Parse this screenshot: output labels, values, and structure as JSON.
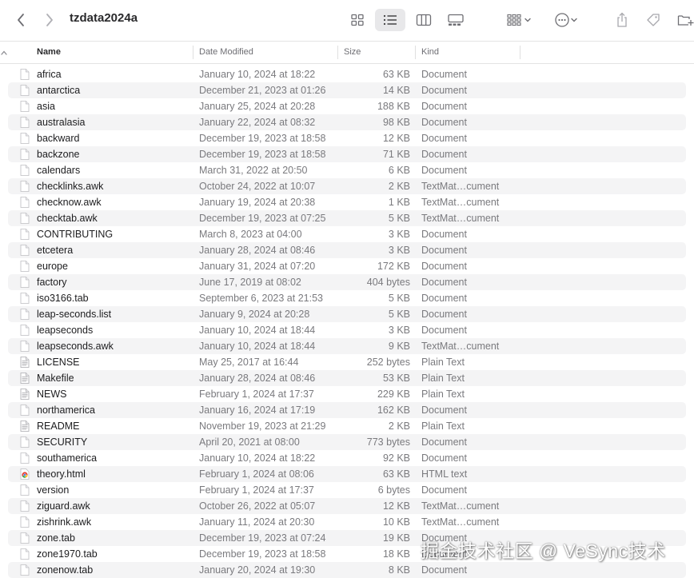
{
  "window": {
    "title": "tzdata2024a"
  },
  "toolbar": {
    "back": "chevron-left-icon",
    "forward": "chevron-right-icon",
    "views": [
      "icon-view-icon",
      "list-view-icon",
      "column-view-icon",
      "gallery-view-icon"
    ],
    "selected_view": "list-view-icon",
    "group": "group-grid-icon",
    "action": "ellipsis-circle-icon",
    "share": "share-icon",
    "tag": "tag-icon",
    "new_folder": "folder-badge-plus-icon"
  },
  "columns": {
    "name": "Name",
    "date_modified": "Date Modified",
    "size": "Size",
    "kind": "Kind",
    "sort_column": "Name",
    "sort_direction": "ascending"
  },
  "files": [
    {
      "name": "africa",
      "date": "January 10, 2024 at 18:22",
      "size": "63 KB",
      "kind": "Document",
      "icon": "document-icon"
    },
    {
      "name": "antarctica",
      "date": "December 21, 2023 at 01:26",
      "size": "14 KB",
      "kind": "Document",
      "icon": "document-icon"
    },
    {
      "name": "asia",
      "date": "January 25, 2024 at 20:28",
      "size": "188 KB",
      "kind": "Document",
      "icon": "document-icon"
    },
    {
      "name": "australasia",
      "date": "January 22, 2024 at 08:32",
      "size": "98 KB",
      "kind": "Document",
      "icon": "document-icon"
    },
    {
      "name": "backward",
      "date": "December 19, 2023 at 18:58",
      "size": "12 KB",
      "kind": "Document",
      "icon": "document-icon"
    },
    {
      "name": "backzone",
      "date": "December 19, 2023 at 18:58",
      "size": "71 KB",
      "kind": "Document",
      "icon": "document-icon"
    },
    {
      "name": "calendars",
      "date": "March 31, 2022 at 20:50",
      "size": "6 KB",
      "kind": "Document",
      "icon": "document-icon"
    },
    {
      "name": "checklinks.awk",
      "date": "October 24, 2022 at 10:07",
      "size": "2 KB",
      "kind": "TextMat…cument",
      "icon": "document-icon"
    },
    {
      "name": "checknow.awk",
      "date": "January 19, 2024 at 20:38",
      "size": "1 KB",
      "kind": "TextMat…cument",
      "icon": "document-icon"
    },
    {
      "name": "checktab.awk",
      "date": "December 19, 2023 at 07:25",
      "size": "5 KB",
      "kind": "TextMat…cument",
      "icon": "document-icon"
    },
    {
      "name": "CONTRIBUTING",
      "date": "March 8, 2023 at 04:00",
      "size": "3 KB",
      "kind": "Document",
      "icon": "document-icon"
    },
    {
      "name": "etcetera",
      "date": "January 28, 2024 at 08:46",
      "size": "3 KB",
      "kind": "Document",
      "icon": "document-icon"
    },
    {
      "name": "europe",
      "date": "January 31, 2024 at 07:20",
      "size": "172 KB",
      "kind": "Document",
      "icon": "document-icon"
    },
    {
      "name": "factory",
      "date": "June 17, 2019 at 08:02",
      "size": "404 bytes",
      "kind": "Document",
      "icon": "document-icon"
    },
    {
      "name": "iso3166.tab",
      "date": "September 6, 2023 at 21:53",
      "size": "5 KB",
      "kind": "Document",
      "icon": "document-icon"
    },
    {
      "name": "leap-seconds.list",
      "date": "January 9, 2024 at 20:28",
      "size": "5 KB",
      "kind": "Document",
      "icon": "document-icon"
    },
    {
      "name": "leapseconds",
      "date": "January 10, 2024 at 18:44",
      "size": "3 KB",
      "kind": "Document",
      "icon": "document-icon"
    },
    {
      "name": "leapseconds.awk",
      "date": "January 10, 2024 at 18:44",
      "size": "9 KB",
      "kind": "TextMat…cument",
      "icon": "document-icon"
    },
    {
      "name": "LICENSE",
      "date": "May 25, 2017 at 16:44",
      "size": "252 bytes",
      "kind": "Plain Text",
      "icon": "text-document-icon"
    },
    {
      "name": "Makefile",
      "date": "January 28, 2024 at 08:46",
      "size": "53 KB",
      "kind": "Plain Text",
      "icon": "text-document-icon"
    },
    {
      "name": "NEWS",
      "date": "February 1, 2024 at 17:37",
      "size": "229 KB",
      "kind": "Plain Text",
      "icon": "text-document-icon"
    },
    {
      "name": "northamerica",
      "date": "January 16, 2024 at 17:19",
      "size": "162 KB",
      "kind": "Document",
      "icon": "document-icon"
    },
    {
      "name": "README",
      "date": "November 19, 2023 at 21:29",
      "size": "2 KB",
      "kind": "Plain Text",
      "icon": "text-document-icon"
    },
    {
      "name": "SECURITY",
      "date": "April 20, 2021 at 08:00",
      "size": "773 bytes",
      "kind": "Document",
      "icon": "document-icon"
    },
    {
      "name": "southamerica",
      "date": "January 10, 2024 at 18:22",
      "size": "92 KB",
      "kind": "Document",
      "icon": "document-icon"
    },
    {
      "name": "theory.html",
      "date": "February 1, 2024 at 08:06",
      "size": "63 KB",
      "kind": "HTML text",
      "icon": "chrome-html-icon"
    },
    {
      "name": "version",
      "date": "February 1, 2024 at 17:37",
      "size": "6 bytes",
      "kind": "Document",
      "icon": "document-icon"
    },
    {
      "name": "ziguard.awk",
      "date": "October 26, 2022 at 05:07",
      "size": "12 KB",
      "kind": "TextMat…cument",
      "icon": "document-icon"
    },
    {
      "name": "zishrink.awk",
      "date": "January 11, 2024 at 20:30",
      "size": "10 KB",
      "kind": "TextMat…cument",
      "icon": "document-icon"
    },
    {
      "name": "zone.tab",
      "date": "December 19, 2023 at 07:24",
      "size": "19 KB",
      "kind": "Document",
      "icon": "document-icon"
    },
    {
      "name": "zone1970.tab",
      "date": "December 19, 2023 at 18:58",
      "size": "18 KB",
      "kind": "Document",
      "icon": "document-icon"
    },
    {
      "name": "zonenow.tab",
      "date": "January 20, 2024 at 19:30",
      "size": "8 KB",
      "kind": "Document",
      "icon": "document-icon"
    }
  ],
  "watermark": "掘金技术社区 @ VeSync技术"
}
